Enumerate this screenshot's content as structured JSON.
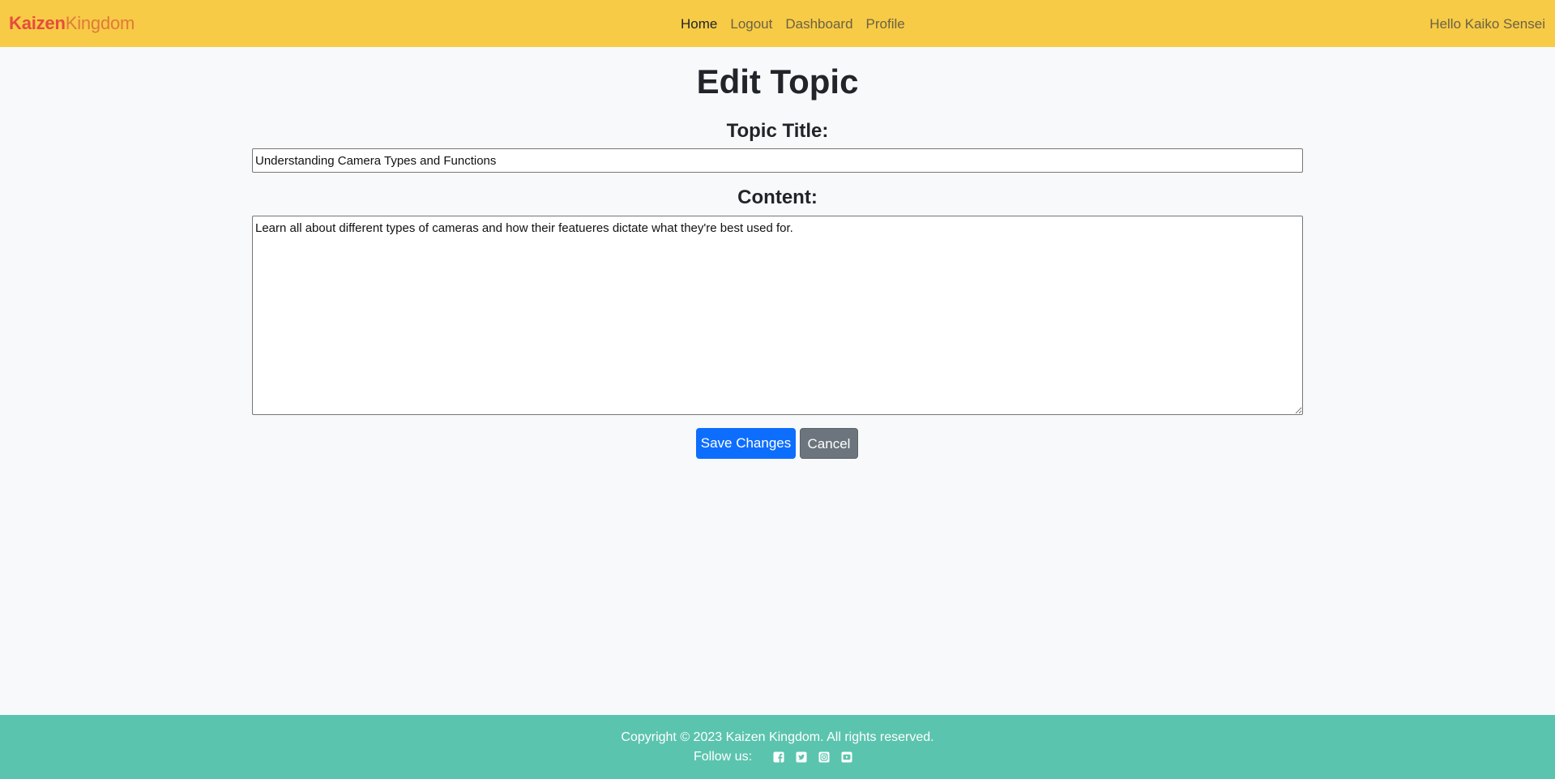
{
  "brand": {
    "part1": "Kaizen",
    "part2": "Kingdom"
  },
  "nav": {
    "links": [
      {
        "label": "Home"
      },
      {
        "label": "Logout"
      },
      {
        "label": "Dashboard"
      },
      {
        "label": "Profile"
      }
    ],
    "greeting": "Hello Kaiko Sensei"
  },
  "page": {
    "title": "Edit Topic",
    "title_label": "Topic Title:",
    "title_value": "Understanding Camera Types and Functions",
    "content_label": "Content:",
    "content_value": "Learn all about different types of cameras and how their featueres dictate what they're best used for."
  },
  "buttons": {
    "save": "Save Changes",
    "cancel": "Cancel"
  },
  "footer": {
    "copyright": "Copyright © 2023 Kaizen Kingdom. All rights reserved.",
    "follow_label": "Follow us:",
    "social_icons": [
      "facebook-icon",
      "twitter-icon",
      "instagram-icon",
      "youtube-icon"
    ]
  },
  "colors": {
    "navbar": "#f7cb46",
    "brand_primary": "#e64c3c",
    "brand_secondary": "#e07a3a",
    "save_button": "#0d6efd",
    "cancel_button": "#6c757d",
    "footer": "#5bc4ae"
  }
}
